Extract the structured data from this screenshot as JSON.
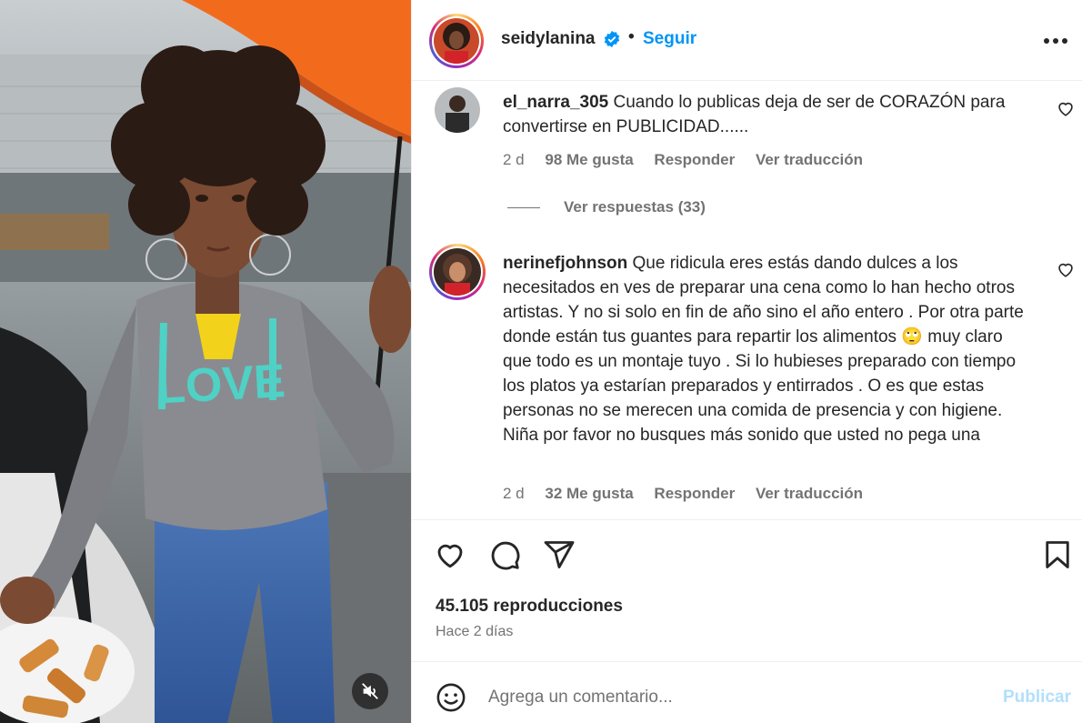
{
  "header": {
    "username": "seidylanina",
    "follow_label": "Seguir",
    "separator": "•"
  },
  "comments": [
    {
      "username": "el_narra_305",
      "text": "Cuando lo publicas deja de ser de CORAZÓN para convertirse en PUBLICIDAD......",
      "time": "2 d",
      "likes": "98 Me gusta",
      "reply_label": "Responder",
      "translate_label": "Ver traducción",
      "view_replies_label": "Ver respuestas (33)"
    },
    {
      "username": "nerinefjohnson",
      "text_part1": "Que ridicula eres estás dando dulces a los necesitados en ves de preparar una cena como lo han hecho otros artistas. Y no si solo en fin de año sino el año entero . Por otra parte donde están tus guantes para repartir los alimentos ",
      "emoji": "🙄",
      "text_part2": " muy claro que todo es un montaje tuyo . Si lo hubieses preparado con tiempo los platos ya estarían preparados y entirrados . O es que estas personas no se merecen una comida de presencia y con higiene. Niña por favor no busques más sonido que usted no pega una",
      "time": "2 d",
      "likes": "32 Me gusta",
      "reply_label": "Responder",
      "translate_label": "Ver traducción"
    }
  ],
  "stats": {
    "views": "45.105 reproducciones",
    "posted_ago": "Hace 2 días"
  },
  "composer": {
    "placeholder": "Agrega un comentario...",
    "post_label": "Publicar"
  },
  "colors": {
    "accent": "#0095f6",
    "post_disabled": "#b2dffc",
    "muted_text": "#737373"
  },
  "icons": [
    "verified-badge-icon",
    "more-options-icon",
    "heart-icon",
    "comment-icon",
    "share-icon",
    "bookmark-icon",
    "emoji-icon",
    "muted-speaker-icon"
  ]
}
